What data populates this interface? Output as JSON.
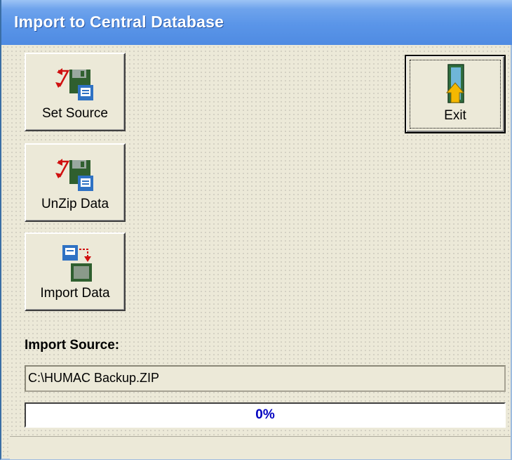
{
  "window": {
    "title": "Import to Central Database"
  },
  "buttons": {
    "set_source": {
      "label": "Set Source",
      "icon": "floppy-transfer-icon"
    },
    "unzip_data": {
      "label": "UnZip Data",
      "icon": "floppy-transfer-icon"
    },
    "import_data": {
      "label": "Import Data",
      "icon": "floppy-import-icon"
    },
    "exit": {
      "label": "Exit",
      "icon": "door-exit-icon"
    }
  },
  "import_source": {
    "label": "Import Source:",
    "path": "C:\\HUMAC Backup.ZIP"
  },
  "progress": {
    "value": 0,
    "text": "0%"
  },
  "colors": {
    "title_bar": "#4f8be2",
    "progress_text": "#0000c0",
    "dialog_background": "#ece9d8"
  }
}
